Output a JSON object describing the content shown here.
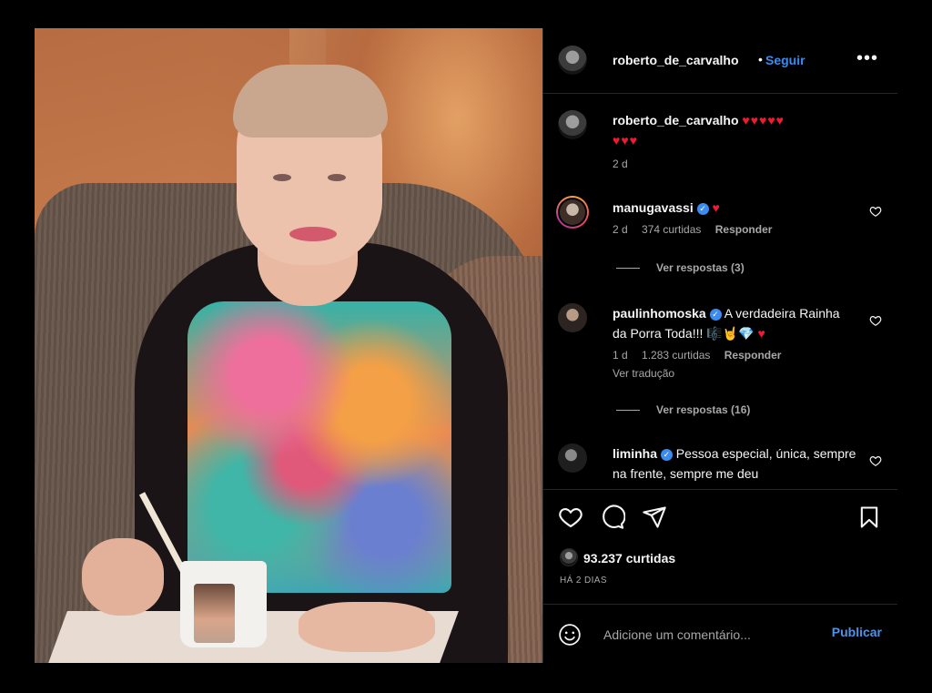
{
  "post": {
    "author": "roberto_de_carvalho",
    "separator": "•",
    "follow_label": "Seguir",
    "more_label": "•••"
  },
  "caption": {
    "username": "roberto_de_carvalho",
    "text": "♥♥♥♥♥",
    "text_line2": "♥♥♥",
    "time": "2 d"
  },
  "comments": [
    {
      "username": "manugavassi",
      "verified": true,
      "text": "♥",
      "time": "2 d",
      "likes": "374 curtidas",
      "reply": "Responder",
      "view_replies": "Ver respostas (3)"
    },
    {
      "username": "paulinhomoska",
      "verified": true,
      "text": "A verdadeira Rainha da Porra Toda!!! 🎼🤘💎",
      "text_heart": "♥",
      "time": "1 d",
      "likes": "1.283 curtidas",
      "reply": "Responder",
      "translate": "Ver tradução",
      "view_replies": "Ver respostas (16)"
    },
    {
      "username": "liminha",
      "verified": true,
      "text": "Pessoa especial, única, sempre na frente, sempre me deu"
    }
  ],
  "actions": {
    "like_icon": "heart-outline-icon",
    "comment_icon": "comment-bubble-icon",
    "share_icon": "paper-plane-icon",
    "save_icon": "bookmark-icon",
    "likes_count": "93.237 curtidas",
    "time_ago": "HÁ 2 DIAS"
  },
  "add_comment": {
    "placeholder": "Adicione um comentário...",
    "publish_label": "Publicar",
    "emoji_icon": "smiley-icon"
  },
  "colors": {
    "background": "#000000",
    "link_blue": "#3b8cf0",
    "heart_red": "#ed1c30",
    "muted_text": "#a8a8a8",
    "divider": "#262626"
  }
}
